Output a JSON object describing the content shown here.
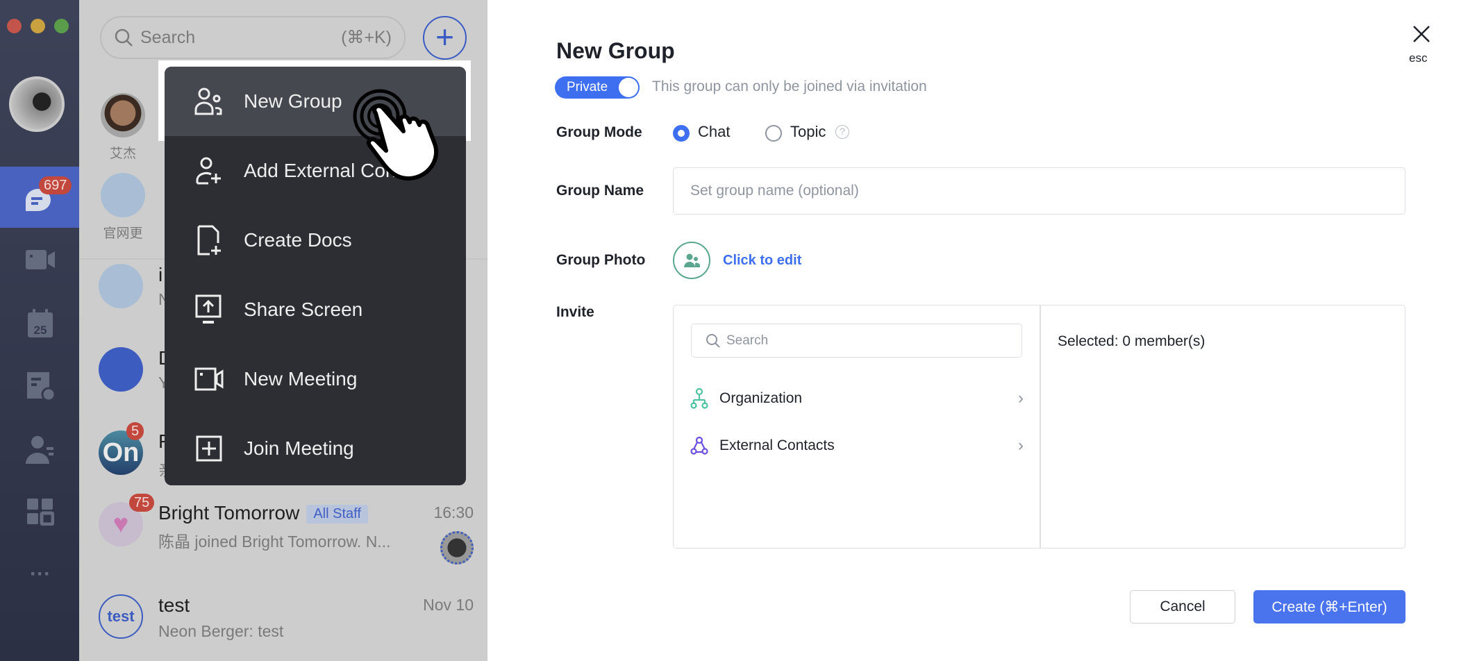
{
  "window": {
    "traffic_lights": [
      "#c2544b",
      "#c9a23f",
      "#5a9c4a"
    ]
  },
  "sidebar": {
    "chat_badge": "697",
    "items": [
      "chat-icon",
      "video-icon",
      "calendar-icon",
      "docs-icon",
      "contacts-icon",
      "apps-icon",
      "more-icon"
    ],
    "calendar_day": "25",
    "more": "···"
  },
  "chat_list": {
    "search_placeholder": "Search",
    "search_shortcut": "(⌘+K)",
    "plus": "+",
    "pinned": [
      {
        "name": "艾杰"
      },
      {
        "name": "官网更"
      }
    ],
    "rows": [
      {
        "title": "i",
        "subtitle": "N",
        "time": "",
        "badge": ""
      },
      {
        "title": "D",
        "subtitle": "Y",
        "time": "",
        "badge": ""
      },
      {
        "title": "F",
        "subtitle": "亲",
        "time": "",
        "badge": "5",
        "avatar_text": "On"
      },
      {
        "title": "Bright Tomorrow",
        "tag": "All Staff",
        "subtitle": "陈晶 joined Bright Tomorrow. N...",
        "time": "16:30",
        "badge": "75"
      },
      {
        "title": "test",
        "subtitle": "Neon Berger: test",
        "time": "Nov 10",
        "badge": "",
        "avatar_text": "test"
      }
    ]
  },
  "menu": {
    "items": [
      {
        "label": "New Group",
        "icon": "group-icon",
        "highlighted": true
      },
      {
        "label": "Add External Conta",
        "icon": "add-contact-icon"
      },
      {
        "label": "Create Docs",
        "icon": "create-doc-icon"
      },
      {
        "label": "Share Screen",
        "icon": "share-screen-icon"
      },
      {
        "label": "New Meeting",
        "icon": "video-icon"
      },
      {
        "label": "Join Meeting",
        "icon": "join-meeting-icon"
      }
    ]
  },
  "dialog": {
    "title": "New Group",
    "privacy_toggle": "Private",
    "privacy_on": true,
    "privacy_desc": "This group can only be joined via invitation",
    "mode_label": "Group Mode",
    "mode_options": [
      "Chat",
      "Topic"
    ],
    "mode_selected": "Chat",
    "help": "?",
    "name_label": "Group Name",
    "name_placeholder": "Set group name (optional)",
    "name_value": "",
    "photo_label": "Group Photo",
    "photo_action": "Click to edit",
    "invite_label": "Invite",
    "invite_search_placeholder": "Search",
    "categories": [
      {
        "label": "Organization",
        "icon": "org-icon",
        "color": "#4fc3a1"
      },
      {
        "label": "External Contacts",
        "icon": "external-contacts-icon",
        "color": "#6b4fe0"
      }
    ],
    "selected": "Selected: 0 member(s)",
    "cancel": "Cancel",
    "create": "Create (⌘+Enter)",
    "close_hint": "esc",
    "accent": "#3d6ff0"
  }
}
